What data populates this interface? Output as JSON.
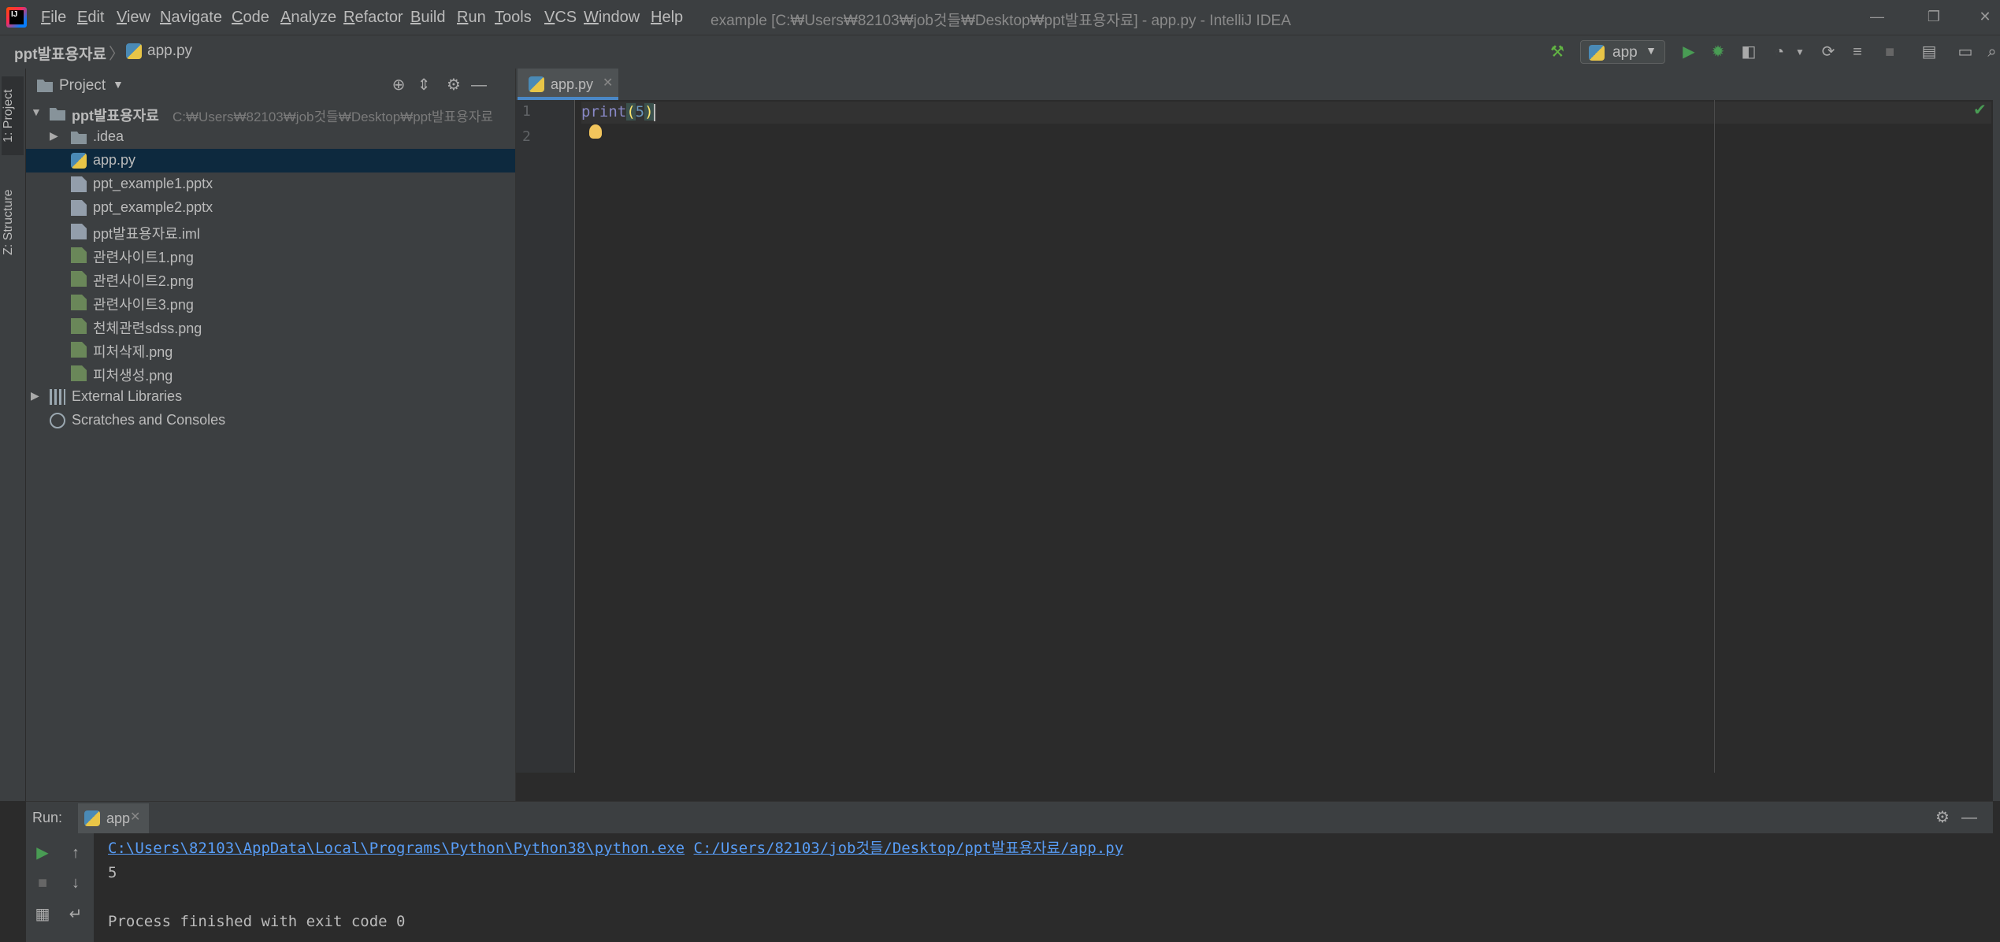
{
  "window": {
    "title": "example [C:₩Users₩82103₩job것들₩Desktop₩ppt발표용자료] - app.py - IntelliJ IDEA",
    "menu": [
      "File",
      "Edit",
      "View",
      "Navigate",
      "Code",
      "Analyze",
      "Refactor",
      "Build",
      "Run",
      "Tools",
      "VCS",
      "Window",
      "Help"
    ]
  },
  "navbar": {
    "root": "ppt발표용자료",
    "file": "app.py",
    "run_config": "app"
  },
  "left_strip": {
    "project_tab": "1: Project",
    "structure_tab": "Z: Structure"
  },
  "project": {
    "title": "Project",
    "root_name": "ppt발표용자료",
    "root_path": "C:₩Users₩82103₩job것들₩Desktop₩ppt발표용자료",
    "items": [
      {
        "name": ".idea",
        "icon": "folder-icon"
      },
      {
        "name": "app.py",
        "icon": "python-file-icon"
      },
      {
        "name": "ppt_example1.pptx",
        "icon": "unknown-file-icon"
      },
      {
        "name": "ppt_example2.pptx",
        "icon": "unknown-file-icon"
      },
      {
        "name": "ppt발표용자료.iml",
        "icon": "iml-file-icon"
      },
      {
        "name": "관련사이트1.png",
        "icon": "image-file-icon"
      },
      {
        "name": "관련사이트2.png",
        "icon": "image-file-icon"
      },
      {
        "name": "관련사이트3.png",
        "icon": "image-file-icon"
      },
      {
        "name": "천체관련sdss.png",
        "icon": "image-file-icon"
      },
      {
        "name": "피처삭제.png",
        "icon": "image-file-icon"
      },
      {
        "name": "피처생성.png",
        "icon": "image-file-icon"
      }
    ],
    "external_libraries": "External Libraries",
    "scratches": "Scratches and Consoles"
  },
  "editor": {
    "tab": "app.py",
    "line_numbers": [
      "1",
      "2"
    ],
    "code": {
      "fn": "print",
      "open": "(",
      "arg": "5",
      "close": ")"
    }
  },
  "run": {
    "label": "Run:",
    "tab": "app",
    "console": {
      "exe": "C:\\Users\\82103\\AppData\\Local\\Programs\\Python\\Python38\\python.exe",
      "script": "C:/Users/82103/job것들/Desktop/ppt발표용자료/app.py",
      "output": "5",
      "finished": "Process finished with exit code 0"
    }
  },
  "colors": {
    "accent": "#4a88c7",
    "selection": "#0d293e",
    "run_green": "#499c54",
    "link": "#589df6"
  }
}
